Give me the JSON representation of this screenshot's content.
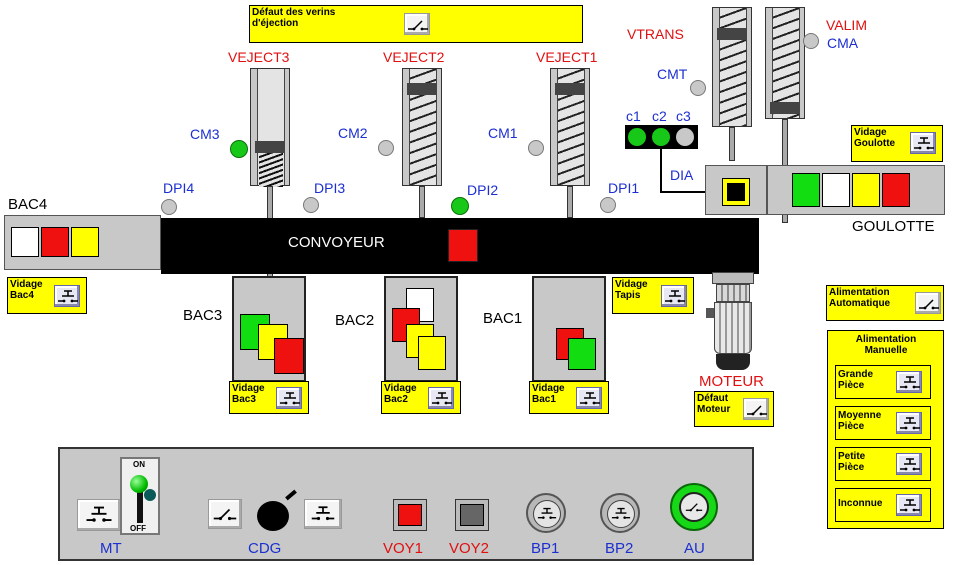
{
  "header_fault": {
    "label": "Défaut des verins d'éjection"
  },
  "cylinders": {
    "veject3": "VEJECT3",
    "veject2": "VEJECT2",
    "veject1": "VEJECT1",
    "vtrans": "VTRANS",
    "valim": "VALIM"
  },
  "sensors": {
    "cm3": "CM3",
    "cm2": "CM2",
    "cm1": "CM1",
    "cmt": "CMT",
    "cma": "CMA",
    "dpi1": "DPI1",
    "dpi2": "DPI2",
    "dpi3": "DPI3",
    "dpi4": "DPI4",
    "dia": "DIA"
  },
  "color_sensors": {
    "c1": "c1",
    "c2": "c2",
    "c3": "c3"
  },
  "conveyor": {
    "label": "CONVOYEUR"
  },
  "goulotte": {
    "label": "GOULOTTE"
  },
  "bins": {
    "bac1": "BAC1",
    "bac2": "BAC2",
    "bac3": "BAC3",
    "bac4": "BAC4"
  },
  "buttons": {
    "vidage_goulotte": "Vidage Goulotte",
    "vidage_bac4": "Vidage Bac4",
    "vidage_tapis": "Vidage Tapis",
    "vidage_bac3": "Vidage Bac3",
    "vidage_bac2": "Vidage Bac2",
    "vidage_bac1": "Vidage Bac1",
    "defaut_moteur": "Défaut Moteur",
    "alim_auto": "Alimentation Automatique"
  },
  "motor": {
    "label": "MOTEUR"
  },
  "manual_feed": {
    "title": "Alimentation Manuelle",
    "grande": "Grande Pièce",
    "moyenne": "Moyenne Pièce",
    "petite": "Petite Pièce",
    "inconnue": "Inconnue"
  },
  "panel": {
    "mt": "MT",
    "on": "ON",
    "off": "OFF",
    "cdg": "CDG",
    "voy1": "VOY1",
    "voy2": "VOY2",
    "bp1": "BP1",
    "bp2": "BP2",
    "au": "AU"
  },
  "colors": {
    "red": "#ef1010",
    "green": "#11dd11",
    "yellow": "#ffff00",
    "blue_label": "#1c2fd1",
    "red_label": "#e01010",
    "panel_gray": "#c8c8c8"
  }
}
